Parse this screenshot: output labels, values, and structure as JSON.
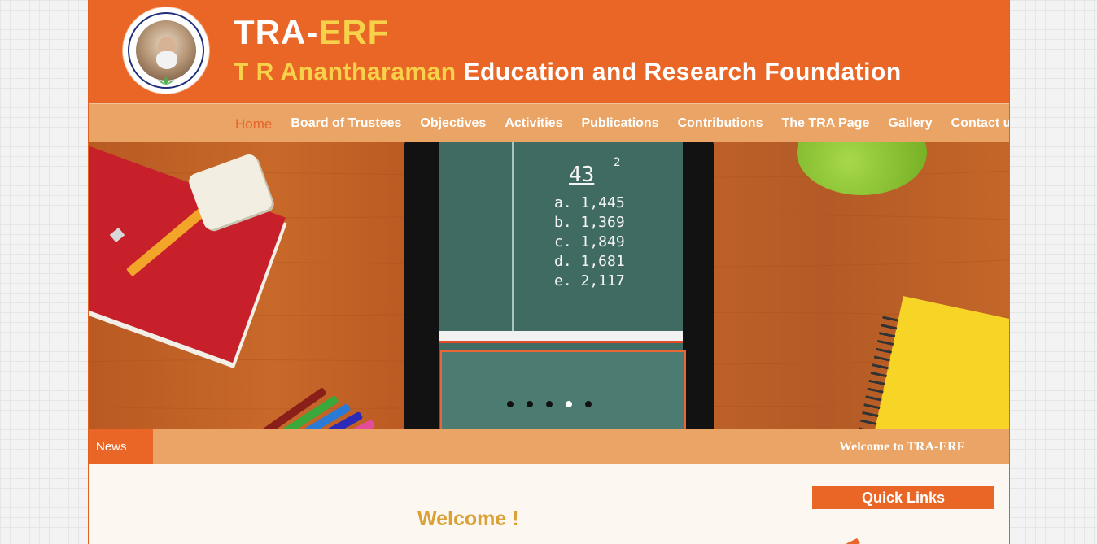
{
  "header": {
    "title_part1": "TRA-",
    "title_part2": "ERF",
    "subtitle_part1": "T R Anantharaman",
    "subtitle_part2": " Education and Research Foundation"
  },
  "nav": {
    "items": [
      {
        "label": "Home",
        "active": true
      },
      {
        "label": "Board of Trustees",
        "active": false
      },
      {
        "label": "Objectives",
        "active": false
      },
      {
        "label": "Activities",
        "active": false
      },
      {
        "label": "Publications",
        "active": false
      },
      {
        "label": "Contributions",
        "active": false
      },
      {
        "label": "The TRA Page",
        "active": false
      },
      {
        "label": "Gallery",
        "active": false
      },
      {
        "label": "Contact us",
        "active": false
      }
    ]
  },
  "slider": {
    "equation_base": "43",
    "equation_exponent": "2",
    "options": [
      "a. 1,445",
      "b. 1,369",
      "c. 1,849",
      "d. 1,681",
      "e. 2,117"
    ],
    "active_slide": 4,
    "slide_count": 5
  },
  "news": {
    "label": "News",
    "ticker": "Welcome to TRA-ERF"
  },
  "content": {
    "welcome_heading": "Welcome !"
  },
  "sidebar": {
    "quick_links_title": "Quick Links"
  },
  "colors": {
    "brand_orange": "#e96627",
    "nav_bg": "#e9a466",
    "accent_yellow": "#f7d14a",
    "welcome_gold": "#d9a136"
  }
}
